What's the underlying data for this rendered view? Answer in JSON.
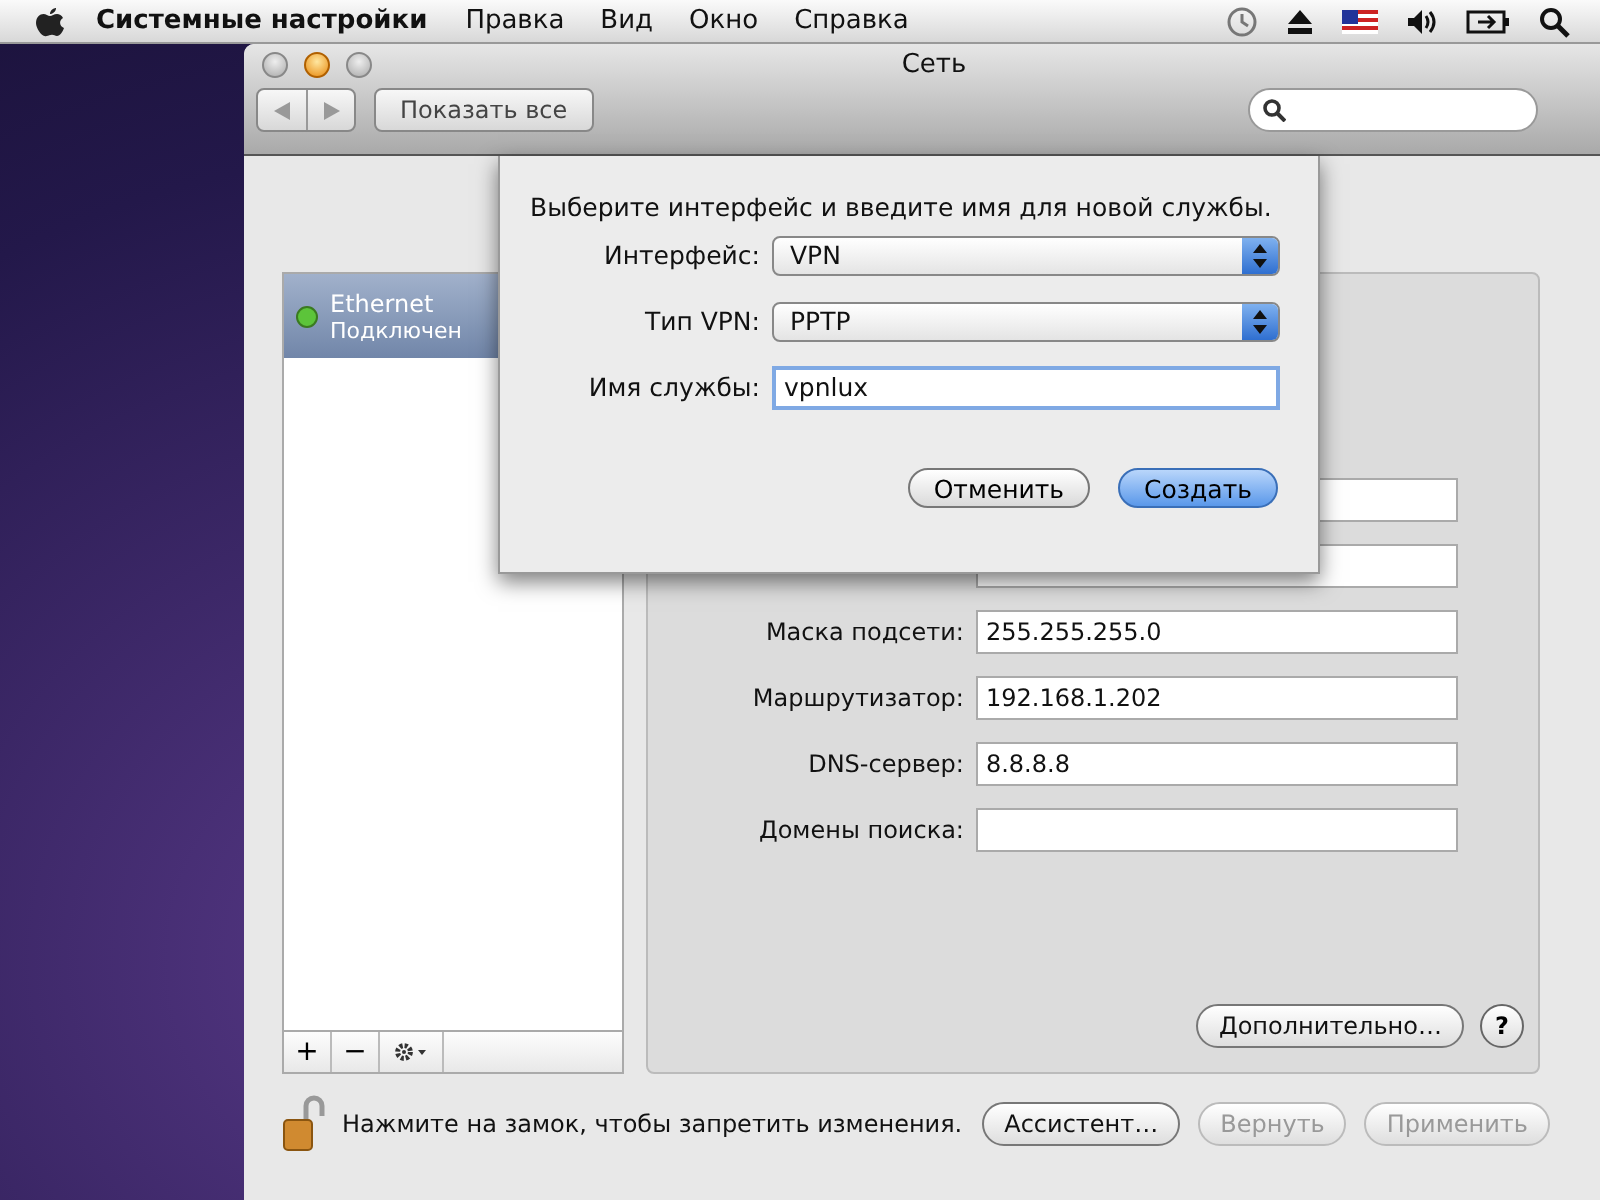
{
  "menubar": {
    "app_name": "Системные настройки",
    "menus": [
      "Правка",
      "Вид",
      "Окно",
      "Справка"
    ]
  },
  "window": {
    "title": "Сеть",
    "show_all_button": "Показать все"
  },
  "services": [
    {
      "name": "Ethernet",
      "status": "Подключен",
      "color": "#5cc43a",
      "selected": true
    }
  ],
  "service_buttons": [
    "+",
    "−"
  ],
  "settings": {
    "fields": [
      {
        "label": "Маска подсети:",
        "value": "255.255.255.0"
      },
      {
        "label": "Маршрутизатор:",
        "value": "192.168.1.202"
      },
      {
        "label": "DNS-сервер:",
        "value": "8.8.8.8"
      },
      {
        "label": "Домены поиска:"
      }
    ],
    "advanced_button": "Дополнительно…",
    "help_button": "?"
  },
  "footer": {
    "lock_text": "Нажмите на замок, чтобы запретить изменения.",
    "buttons": [
      {
        "label": "Ассистент…",
        "disabled": false
      },
      {
        "label": "Вернуть",
        "disabled": true
      },
      {
        "label": "Применить",
        "disabled": true
      }
    ]
  },
  "sheet": {
    "prompt": "Выберите интерфейс и введите имя для новой службы.",
    "rows": [
      {
        "kind": "popup",
        "label": "Интерфейс:",
        "value": "VPN"
      },
      {
        "kind": "popup",
        "label": "Тип VPN:",
        "value": "PPTP"
      },
      {
        "kind": "text",
        "label": "Имя службы:",
        "value": "vpnlux"
      }
    ],
    "buttons": [
      {
        "label": "Отменить",
        "default": false
      },
      {
        "label": "Создать",
        "default": true
      }
    ]
  }
}
